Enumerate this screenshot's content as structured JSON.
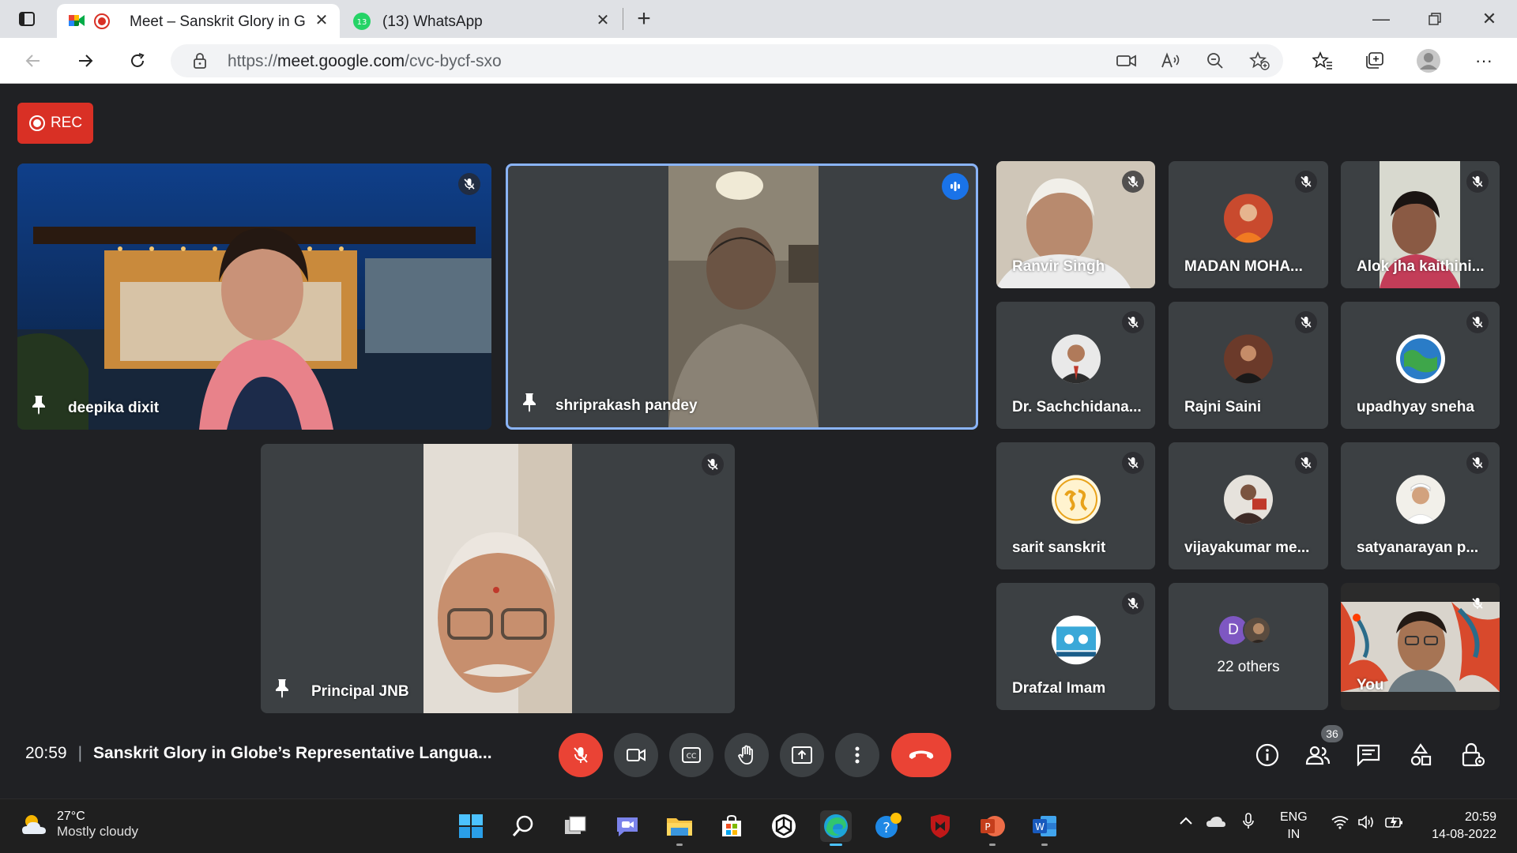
{
  "browser": {
    "tabs": [
      {
        "title": "Meet – Sanskrit Glory in Glo",
        "active": true,
        "icon": "google-meet-icon"
      },
      {
        "title": "(13) WhatsApp",
        "active": false,
        "icon": "whatsapp-icon",
        "badge": "13"
      }
    ],
    "url_prefix": "https://",
    "url_host": "meet.google.com",
    "url_path": "/cvc-bycf-sxo"
  },
  "meet": {
    "rec_label": "REC",
    "featured": [
      {
        "name": "deepika dixit"
      },
      {
        "name": "shriprakash pandey"
      },
      {
        "name": "Principal JNB"
      }
    ],
    "grid": [
      {
        "name": "Ranvir Singh"
      },
      {
        "name": "MADAN MOHA..."
      },
      {
        "name": "Alok jha kaithini..."
      },
      {
        "name": "Dr. Sachchidana..."
      },
      {
        "name": "Rajni Saini"
      },
      {
        "name": "upadhyay sneha"
      },
      {
        "name": "sarit sanskrit"
      },
      {
        "name": "vijayakumar me..."
      },
      {
        "name": "satyanarayan p..."
      },
      {
        "name": "Drafzal Imam"
      },
      {
        "name": "22 others",
        "avatar_letter": "D"
      },
      {
        "name": "You"
      }
    ],
    "clock": "20:59",
    "meeting_title": "Sanskrit Glory in Globe’s Representative Langua...",
    "participant_count": "36"
  },
  "taskbar": {
    "temperature": "27°C",
    "weather": "Mostly cloudy",
    "lang_1": "ENG",
    "lang_2": "IN",
    "time": "20:59",
    "date": "14-08-2022"
  },
  "colors": {
    "meet_bg": "#202124",
    "tile_bg": "#3c4043",
    "red": "#ea4335",
    "active_speaker_border": "#8ab4f8"
  }
}
